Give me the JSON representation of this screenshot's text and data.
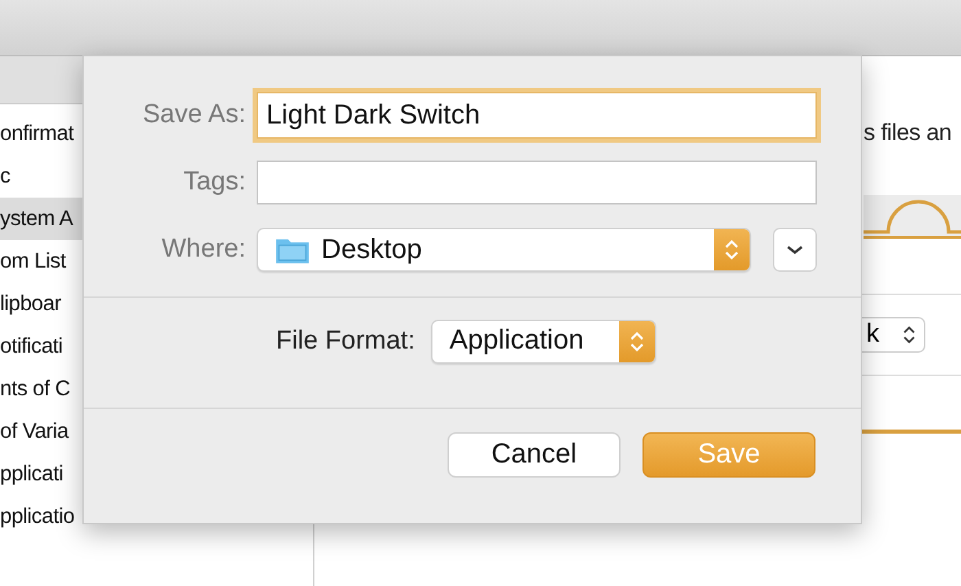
{
  "background_window": {
    "sidebar_items": [
      {
        "label": "onfirmat",
        "selected": false
      },
      {
        "label": "c",
        "selected": false
      },
      {
        "label": "ystem A",
        "selected": true
      },
      {
        "label": "om List",
        "selected": false
      },
      {
        "label": "lipboar",
        "selected": false
      },
      {
        "label": "otificati",
        "selected": false
      },
      {
        "label": "nts of C",
        "selected": false
      },
      {
        "label": "of Varia",
        "selected": false
      },
      {
        "label": "pplicati",
        "selected": false
      },
      {
        "label": "pplicatio",
        "selected": false
      }
    ],
    "description": "s files an",
    "popup_value": "k"
  },
  "dialog": {
    "save_as": {
      "label": "Save As:",
      "value": "Light Dark Switch",
      "focused": true
    },
    "tags": {
      "label": "Tags:"
    },
    "where": {
      "label": "Where:",
      "value": "Desktop"
    },
    "file_format": {
      "label": "File Format:",
      "value": "Application"
    },
    "buttons": [
      {
        "label": "Cancel",
        "kind": "secondary"
      },
      {
        "label": "Save",
        "kind": "primary"
      }
    ]
  }
}
